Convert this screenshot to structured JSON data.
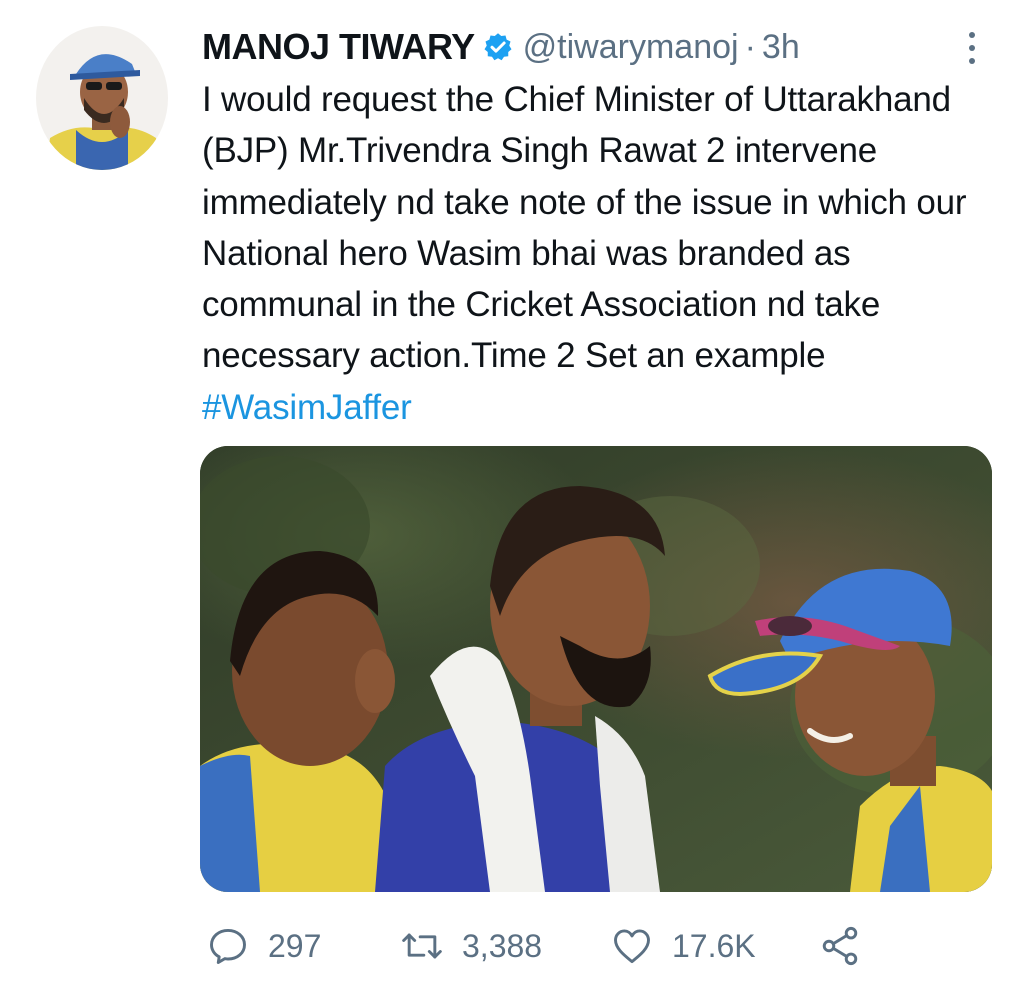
{
  "author": {
    "name": "MANOJ TIWARY",
    "handle": "@tiwarymanoj",
    "separator": "·",
    "timestamp": "3h",
    "verified": true
  },
  "tweet": {
    "text": "I would request the Chief Minister of Uttarakhand (BJP) Mr.Trivendra Singh Rawat 2 intervene immediately nd take note of the issue in which our National hero Wasim bhai was branded as communal in the Cricket Association nd take necessary action.Time 2 Set an example ",
    "hashtag": "#WasimJaffer"
  },
  "actions": {
    "replies": "297",
    "retweets": "3,388",
    "likes": "17.6K"
  },
  "icons": {
    "reply": "speech-bubble-icon",
    "retweet": "retweet-arrows-icon",
    "like": "heart-icon",
    "share": "share-nodes-icon",
    "more": "vertical-dots-icon",
    "verified": "verified-badge-icon"
  },
  "colors": {
    "text": "#0f1419",
    "secondary": "#5b7083",
    "link": "#1b95e0",
    "verified": "#1da1f2"
  }
}
